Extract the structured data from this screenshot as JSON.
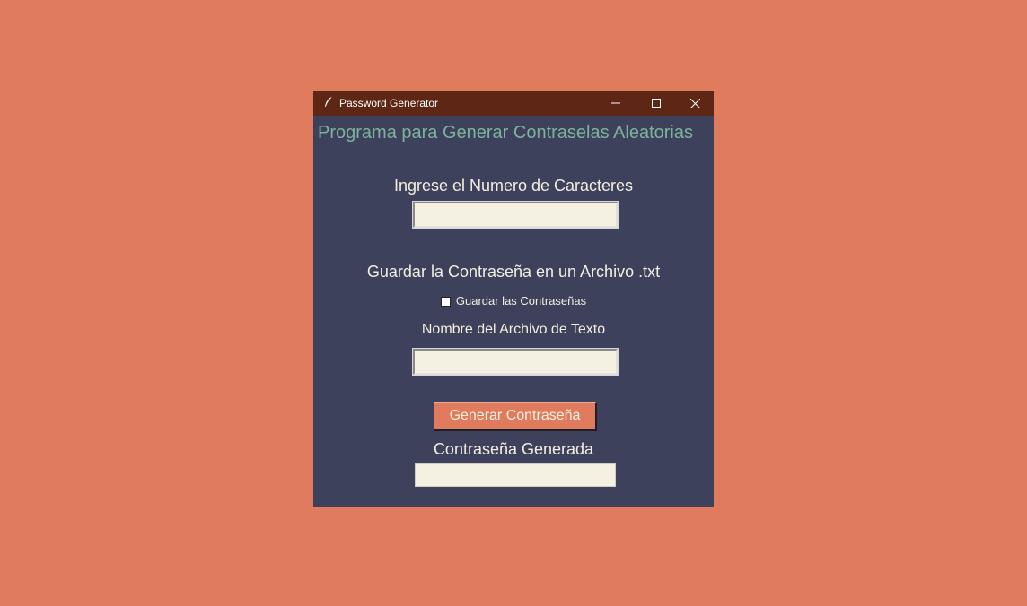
{
  "window": {
    "title": "Password Generator",
    "minimize_icon": "minimize-icon",
    "maximize_icon": "maximize-icon",
    "close_icon": "close-icon",
    "app_icon": "feather-icon"
  },
  "main": {
    "heading": "Programa para Generar Contraselas Aleatorias",
    "chars_label": "Ingrese el Numero de Caracteres",
    "chars_value": "",
    "save_label": "Guardar la Contraseña en un Archivo .txt",
    "save_checkbox_label": "Guardar las Contraseñas",
    "save_checked": false,
    "file_label": "Nombre del Archivo de Texto",
    "file_value": "",
    "generate_button": "Generar Contraseña",
    "generated_label": "Contraseña Generada",
    "generated_value": ""
  },
  "colors": {
    "desktop": "#e07b5d",
    "window_bg": "#3d415c",
    "titlebar": "#5e2614",
    "heading": "#7fb29a",
    "label": "#f2efe0",
    "entry_bg": "#f4f1e2",
    "button_bg": "#e07b5d"
  }
}
